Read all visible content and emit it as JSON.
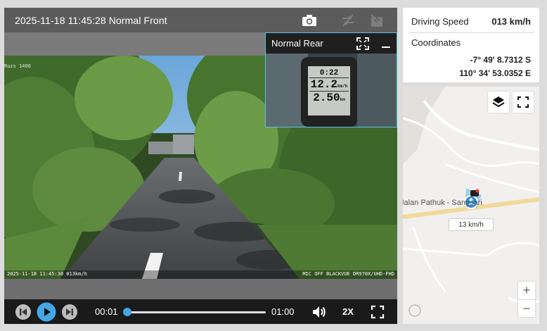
{
  "front": {
    "header_title": "2025-11-18 11:45:28 Normal Front",
    "osd_top": "Ruzs 1406",
    "osd_left": "2025-11-18 11:45:30 013km/h",
    "osd_right": "MIC OFF BLACKVUE DR970X/UHD-FHD"
  },
  "rear": {
    "title": "Normal Rear",
    "meter": {
      "time": "0:22",
      "speed": "12.2",
      "speed_unit": "km/h",
      "distance": "2.50",
      "distance_unit": "km"
    }
  },
  "player": {
    "current_time": "00:01",
    "total_time": "01:00",
    "progress": 0.02,
    "rate": "2X"
  },
  "info": {
    "speed_label": "Driving Speed",
    "speed_value": "013 km/h",
    "coords_label": "Coordinates",
    "lat": "-7° 49' 8.7312 S",
    "lon": "110° 34' 53.0352 E"
  },
  "map": {
    "road_label": "Jalan Pathuk - Sangsari",
    "marker_speed": "13 km/h",
    "zoom_in": "+",
    "zoom_out": "−"
  }
}
